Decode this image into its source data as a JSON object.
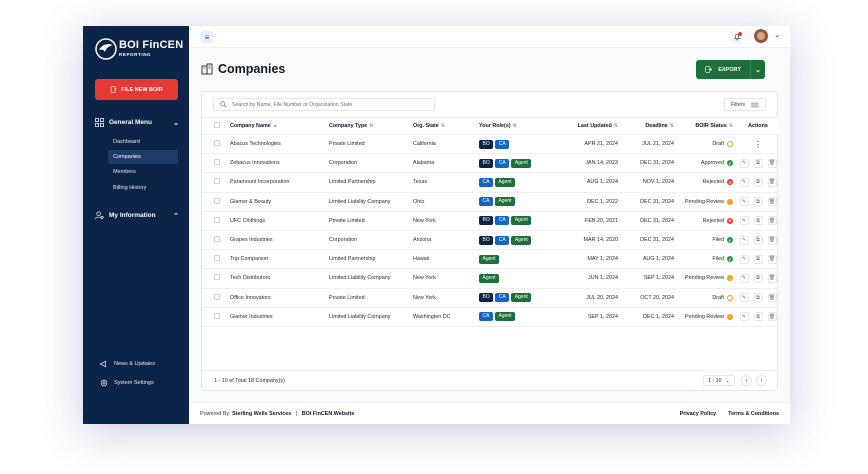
{
  "sidebar": {
    "logo_text": "BOI FinCEN",
    "logo_sub": "REPORTING",
    "file_button": "FILE NEW BOIR",
    "general_menu": "General Menu",
    "items": [
      {
        "label": "Dashboard"
      },
      {
        "label": "Companies"
      },
      {
        "label": "Members"
      },
      {
        "label": "Billing History"
      }
    ],
    "my_information": "My Information",
    "news": "News & Updates",
    "settings": "System Settings"
  },
  "header": {
    "title": "Companies",
    "export_label": "EXPORT"
  },
  "search": {
    "placeholder": "Search by Name, File Number or Organization State",
    "filters_label": "Filters"
  },
  "table": {
    "columns": [
      "Company Name",
      "Company Type",
      "Org. State",
      "Your Role(s)",
      "Last Updated",
      "Deadline",
      "BOIR Status",
      "Actions"
    ],
    "rows": [
      {
        "name": "Abacus Technologies",
        "type": "Private Limited",
        "state": "California",
        "roles": [
          "BO",
          "CA"
        ],
        "updated": "APR 21, 2024",
        "deadline": "JUL 21, 2024",
        "status": "Draft",
        "status_kind": "draft"
      },
      {
        "name": "Zebacus Innovations",
        "type": "Corporation",
        "state": "Alabama",
        "roles": [
          "BO",
          "CA",
          "Agent"
        ],
        "updated": "JAN 14, 2023",
        "deadline": "DEC 31, 2024",
        "status": "Approved",
        "status_kind": "approved"
      },
      {
        "name": "Paramount Incorporation",
        "type": "Limited Partnership",
        "state": "Texas",
        "roles": [
          "CA",
          "Agent"
        ],
        "updated": "AUG 1, 2024",
        "deadline": "NOV 1, 2024",
        "status": "Rejected",
        "status_kind": "rejected"
      },
      {
        "name": "Glamor & Beauty",
        "type": "Limited Liability Company",
        "state": "Ohio",
        "roles": [
          "CA",
          "Agent"
        ],
        "updated": "DEC 1, 2022",
        "deadline": "DEC 31, 2024",
        "status": "Pending Review",
        "status_kind": "pending"
      },
      {
        "name": "UFC Clothings",
        "type": "Private Limited",
        "state": "New York",
        "roles": [
          "BO",
          "CA",
          "Agent"
        ],
        "updated": "FEB 20, 2021",
        "deadline": "DEC 31, 2024",
        "status": "Rejected",
        "status_kind": "rejected"
      },
      {
        "name": "Grapes Industries",
        "type": "Corporation",
        "state": "Arizona",
        "roles": [
          "BO",
          "CA",
          "Agent"
        ],
        "updated": "MAR 14, 2020",
        "deadline": "DEC 31, 2024",
        "status": "Filed",
        "status_kind": "filed"
      },
      {
        "name": "Trip Companion",
        "type": "Limited Partnership",
        "state": "Hawaii",
        "roles": [
          "Agent"
        ],
        "updated": "MAY 1, 2024",
        "deadline": "AUG 1, 2024",
        "status": "Filed",
        "status_kind": "filed"
      },
      {
        "name": "Tech Distributors",
        "type": "Limited Liability Company",
        "state": "New York",
        "roles": [
          "Agent"
        ],
        "updated": "JUN 1, 2024",
        "deadline": "SEP 1, 2024",
        "status": "Pending Review",
        "status_kind": "pending"
      },
      {
        "name": "Office Innovators",
        "type": "Private Limited",
        "state": "New York",
        "roles": [
          "BO",
          "CA",
          "Agent"
        ],
        "updated": "JUL 20, 2024",
        "deadline": "OCT 20, 2024",
        "status": "Draft",
        "status_kind": "draft"
      },
      {
        "name": "Glamor Industries",
        "type": "Limited Liability Company",
        "state": "Washington DC",
        "roles": [
          "CA",
          "Agent"
        ],
        "updated": "SEP 1, 2024",
        "deadline": "DEC 1, 2024",
        "status": "Pending Review",
        "status_kind": "pending"
      }
    ]
  },
  "pagination": {
    "summary": "1 - 10 of Total 18 Company(s)",
    "range": "1 - 10"
  },
  "footer": {
    "powered_prefix": "Powered By:",
    "powered_by": "Sterling Wells Services",
    "separator": "|",
    "site": "BOI FinCEN Website",
    "privacy": "Privacy Policy",
    "terms": "Terms & Conditions"
  },
  "colors": {
    "sidebar": "#0b2447",
    "file_button": "#e53935",
    "export_button": "#1f6f3a",
    "role_bo": "#0b2447",
    "role_ca": "#1565c0",
    "role_agent": "#1f6f3a"
  }
}
